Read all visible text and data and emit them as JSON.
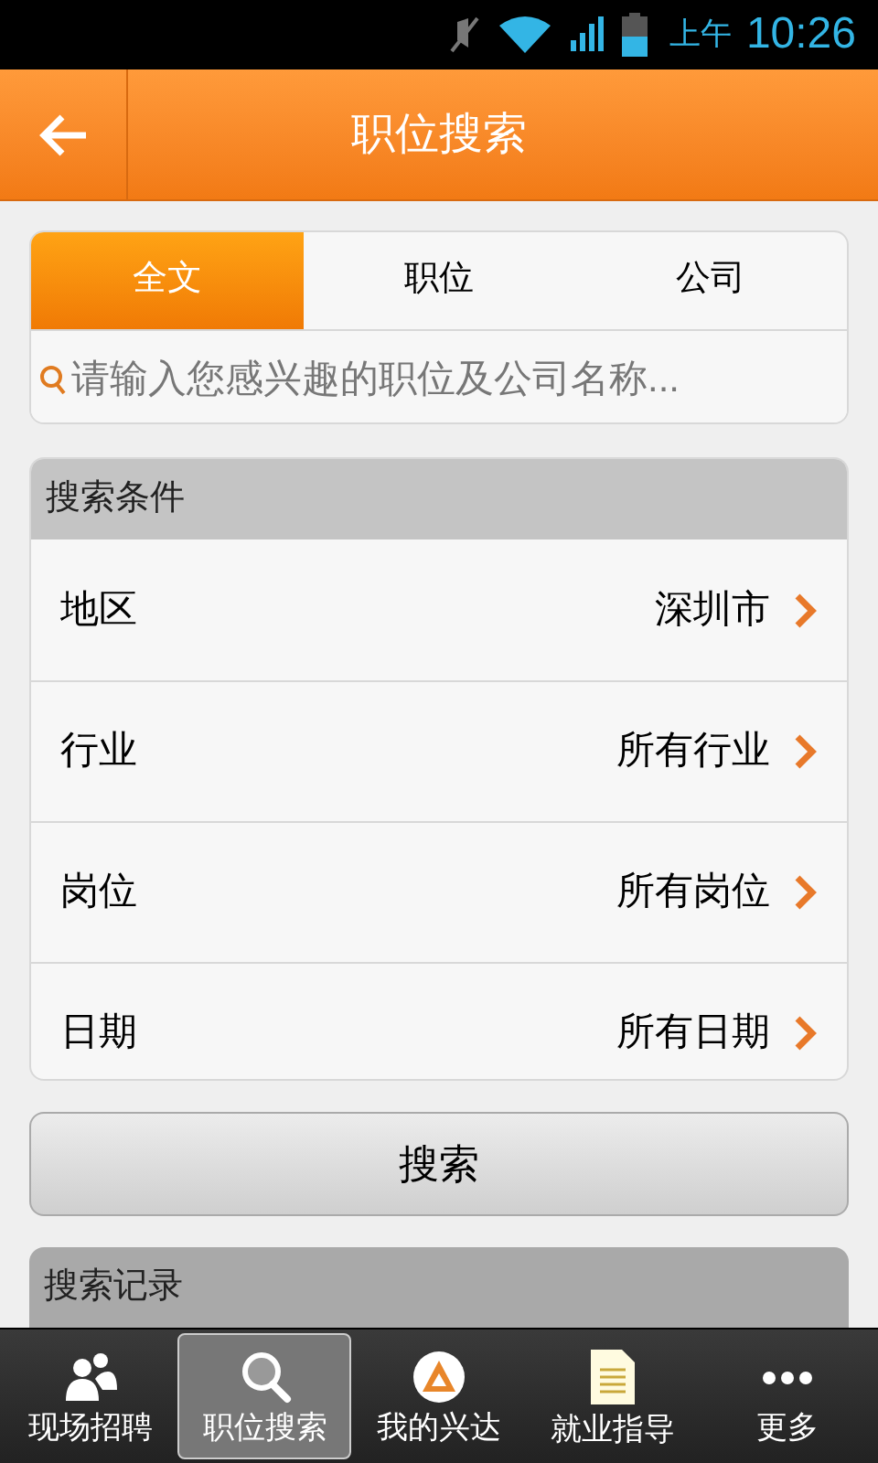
{
  "status_bar": {
    "period": "上午",
    "time": "10:26"
  },
  "header": {
    "title": "职位搜索"
  },
  "tabs": [
    {
      "label": "全文",
      "selected": true
    },
    {
      "label": "职位",
      "selected": false
    },
    {
      "label": "公司",
      "selected": false
    }
  ],
  "search": {
    "placeholder": "请输入您感兴趣的职位及公司名称..."
  },
  "conditions": {
    "title": "搜索条件",
    "rows": [
      {
        "label": "地区",
        "value": "深圳市"
      },
      {
        "label": "行业",
        "value": "所有行业"
      },
      {
        "label": "岗位",
        "value": "所有岗位"
      },
      {
        "label": "日期",
        "value": "所有日期"
      }
    ]
  },
  "search_button": "搜索",
  "history": {
    "title": "搜索记录"
  },
  "bottom_nav": [
    {
      "label": "现场招聘",
      "kind": "people",
      "selected": false
    },
    {
      "label": "职位搜索",
      "kind": "search",
      "selected": true
    },
    {
      "label": "我的兴达",
      "kind": "logo",
      "selected": false
    },
    {
      "label": "就业指导",
      "kind": "doc",
      "selected": false
    },
    {
      "label": "更多",
      "kind": "more",
      "selected": false
    }
  ]
}
